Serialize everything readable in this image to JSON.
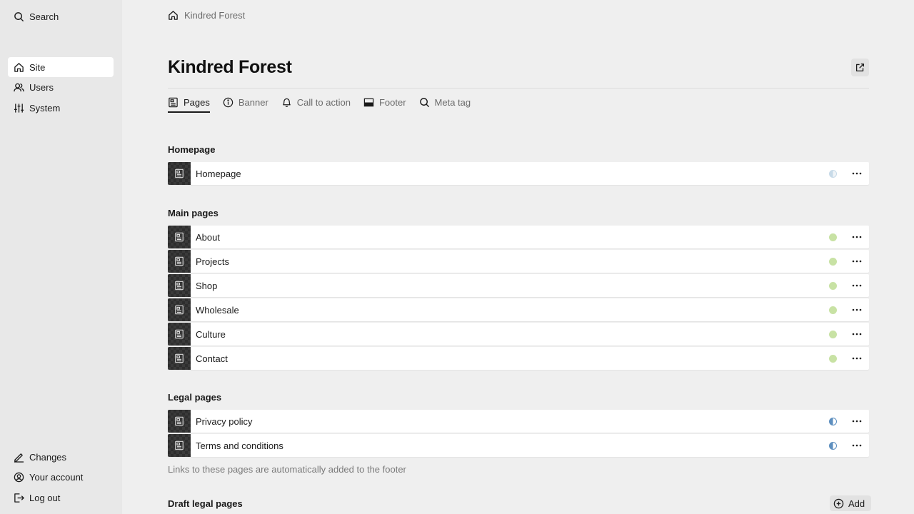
{
  "sidebar": {
    "search": {
      "label": "Search",
      "icon": "search-icon"
    },
    "items": [
      {
        "label": "Site",
        "icon": "home-icon",
        "active": true
      },
      {
        "label": "Users",
        "icon": "users-icon"
      },
      {
        "label": "System",
        "icon": "sliders-icon"
      }
    ],
    "bottom": [
      {
        "label": "Changes",
        "icon": "pencil-icon"
      },
      {
        "label": "Your account",
        "icon": "account-icon"
      },
      {
        "label": "Log out",
        "icon": "logout-icon"
      }
    ]
  },
  "breadcrumb": {
    "label": "Kindred Forest",
    "icon": "home-icon"
  },
  "page": {
    "title": "Kindred Forest",
    "open_icon": "external-link-icon"
  },
  "tabs": [
    {
      "label": "Pages",
      "icon": "page-icon",
      "active": true
    },
    {
      "label": "Banner",
      "icon": "info-icon"
    },
    {
      "label": "Call to action",
      "icon": "bell-icon"
    },
    {
      "label": "Footer",
      "icon": "footer-icon"
    },
    {
      "label": "Meta tag",
      "icon": "search-icon"
    }
  ],
  "sections": {
    "homepage": {
      "label": "Homepage",
      "rows": [
        {
          "label": "Homepage",
          "status": "partial-light"
        }
      ]
    },
    "main": {
      "label": "Main pages",
      "rows": [
        {
          "label": "About",
          "status": "published"
        },
        {
          "label": "Projects",
          "status": "published"
        },
        {
          "label": "Shop",
          "status": "published"
        },
        {
          "label": "Wholesale",
          "status": "published"
        },
        {
          "label": "Culture",
          "status": "published"
        },
        {
          "label": "Contact",
          "status": "published"
        }
      ]
    },
    "legal": {
      "label": "Legal pages",
      "rows": [
        {
          "label": "Privacy policy",
          "status": "partial"
        },
        {
          "label": "Terms and conditions",
          "status": "partial"
        }
      ],
      "help": "Links to these pages are automatically added to the footer"
    },
    "draft_legal": {
      "label": "Draft legal pages",
      "add_label": "Add"
    }
  },
  "colors": {
    "published": "#c8e2a4",
    "partial": "#5d8fbf",
    "partial_light": "#c7dae8"
  }
}
